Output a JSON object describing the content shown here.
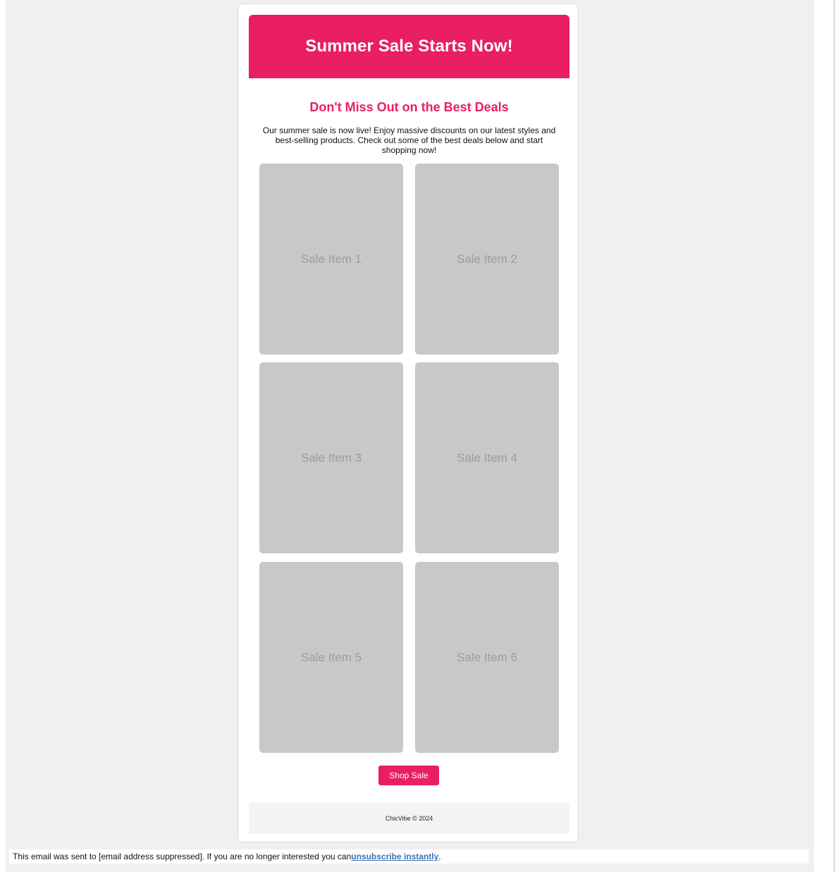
{
  "hero": {
    "title": "Summer Sale Starts Now!"
  },
  "main": {
    "subhead": "Don't Miss Out on the Best Deals",
    "intro": "Our summer sale is now live! Enjoy massive discounts on our latest styles and best-selling products. Check out some of the best deals below and start shopping now!",
    "items": [
      {
        "label": "Sale Item 1"
      },
      {
        "label": "Sale Item 2"
      },
      {
        "label": "Sale Item 3"
      },
      {
        "label": "Sale Item 4"
      },
      {
        "label": "Sale Item 5"
      },
      {
        "label": "Sale Item 6"
      }
    ],
    "cta_label": "Shop Sale"
  },
  "footer": {
    "text": "ChicVibe © 2024"
  },
  "notice": {
    "prefix": "This email was sent to [email address suppressed]. If you are no longer interested you can ",
    "link": "unsubscribe instantly",
    "suffix": "."
  },
  "colors": {
    "accent": "#e91e63",
    "placeholder": "#c8c8c8",
    "page_background": "#f0f0f0",
    "link": "#3a72b8"
  }
}
